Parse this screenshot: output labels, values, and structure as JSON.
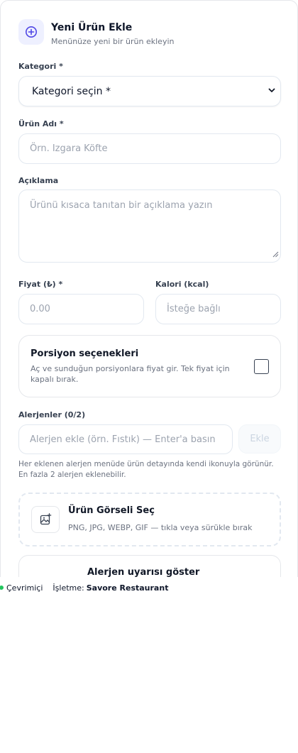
{
  "header": {
    "title": "Yeni Ürün Ekle",
    "subtitle": "Menünüze yeni bir ürün ekleyin",
    "icon": "plus-circle-icon"
  },
  "form": {
    "category": {
      "label": "Kategori *",
      "selected": "Kategori seçin *"
    },
    "product_name": {
      "label": "Ürün Adı *",
      "placeholder": "Örn. Izgara Köfte"
    },
    "description": {
      "label": "Açıklama",
      "placeholder": "Ürünü kısaca tanıtan bir açıklama yazın"
    },
    "price": {
      "label": "Fiyat (₺) *",
      "placeholder": "0.00"
    },
    "calories": {
      "label": "Kalori (kcal)",
      "placeholder": "İsteğe bağlı"
    },
    "portion": {
      "title": "Porsiyon seçenekleri",
      "description": "Aç ve sunduğun porsiyonlara fiyat gir. Tek fiyat için kapalı bırak.",
      "checked": false
    },
    "allergens": {
      "label": "Alerjenler (0/2)",
      "placeholder": "Alerjen ekle (örn. Fıstık) — Enter'a basın",
      "add_label": "Ekle",
      "hint": "Her eklenen alerjen menüde ürün detayında kendi ikonuyla görünür. En fazla 2 alerjen eklenebilir."
    },
    "image": {
      "title": "Ürün Görseli Seç",
      "subtitle": "PNG, JPG, WEBP, GIF — tıkla veya sürükle bırak",
      "icon": "image-plus-icon"
    },
    "allergy_warning": {
      "title": "Alerjen uyarısı göster"
    }
  },
  "status_bar": {
    "online": "Çevrimiçi",
    "business_label": "İşletme:",
    "business_name": "Savore Restaurant",
    "online_color": "#22c55e"
  },
  "colors": {
    "accent": "#4f46e5",
    "accent_bg": "#eef0ff"
  }
}
